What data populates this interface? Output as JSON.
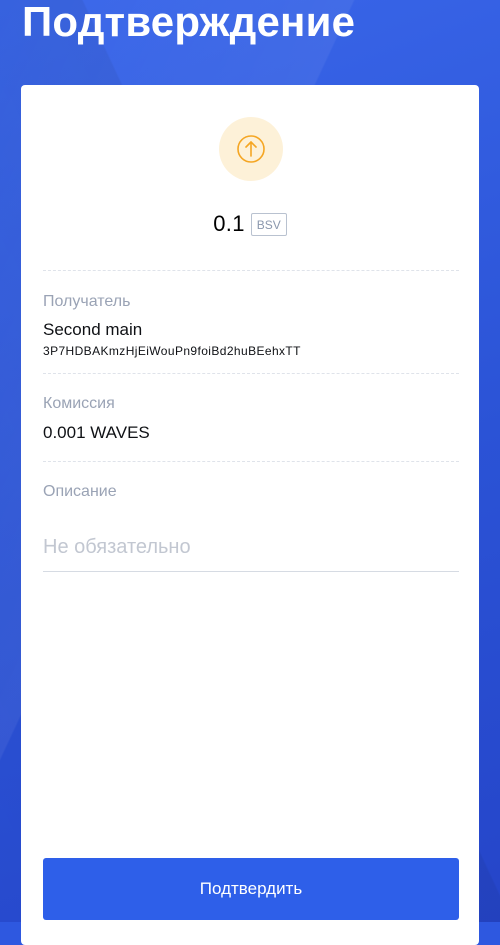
{
  "header": {
    "title": "Подтверждение"
  },
  "transaction": {
    "icon": "arrow-up-circle-icon",
    "icon_color": "#f5a623",
    "amount": "0.1",
    "asset": "BSV"
  },
  "recipient": {
    "label": "Получатель",
    "name": "Second main",
    "address": "3P7HDBAKmzHjEiWouPn9foiBd2huBEehxTT"
  },
  "fee": {
    "label": "Комиссия",
    "value": "0.001 WAVES"
  },
  "description": {
    "label": "Описание",
    "placeholder": "Не обязательно",
    "value": ""
  },
  "actions": {
    "confirm_label": "Подтвердить"
  },
  "colors": {
    "background": "#2e58e0",
    "accent": "#2e5fe9",
    "label_gray": "#9aa3b5"
  }
}
